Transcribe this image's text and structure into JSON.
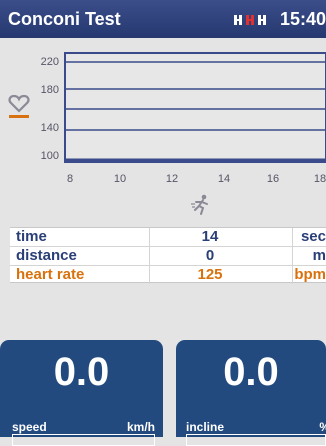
{
  "header": {
    "title": "Conconi Test",
    "time": "15:40"
  },
  "chart": {
    "y_ticks": [
      "220",
      "180",
      "140",
      "100"
    ],
    "x_ticks": [
      "8",
      "10",
      "12",
      "14",
      "16",
      "18"
    ]
  },
  "stats": [
    {
      "label": "time",
      "value": "14",
      "unit": "sec"
    },
    {
      "label": "distance",
      "value": "0",
      "unit": "m"
    },
    {
      "label": "heart rate",
      "value": "125",
      "unit": "bpm"
    }
  ],
  "panels": {
    "speed": {
      "value": "0.0",
      "label": "speed",
      "unit": "km/h"
    },
    "incline": {
      "value": "0.0",
      "label": "incline",
      "unit": "%"
    }
  },
  "colors": {
    "header": "#26386f",
    "accent": "#d8720e",
    "panel": "#234a7f",
    "text": "#2a3f78"
  }
}
